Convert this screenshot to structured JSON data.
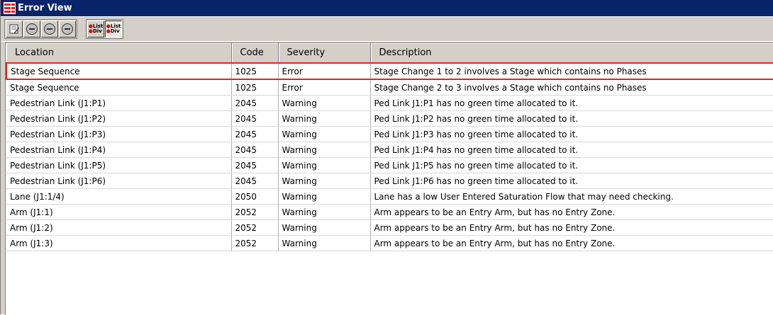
{
  "window": {
    "title": "Error View"
  },
  "toolbar": {
    "buttons": [
      {
        "name": "edit-icon"
      },
      {
        "name": "first-icon"
      },
      {
        "name": "previous-icon"
      },
      {
        "name": "next-icon"
      }
    ],
    "view_buttons": [
      {
        "name": "list-view-icon",
        "lines": [
          "List",
          "Div"
        ]
      },
      {
        "name": "detail-view-icon",
        "lines": [
          "List",
          "Div"
        ]
      }
    ]
  },
  "table": {
    "columns": [
      "Location",
      "Code",
      "Severity",
      "Description"
    ],
    "rows": [
      {
        "location": "Stage Sequence",
        "code": "1025",
        "severity": "Error",
        "description": "Stage Change 1 to 2 involves a Stage which contains no Phases"
      },
      {
        "location": "Stage Sequence",
        "code": "1025",
        "severity": "Error",
        "description": "Stage Change 2 to 3 involves a Stage which contains no Phases"
      },
      {
        "location": "Pedestrian Link (J1:P1)",
        "code": "2045",
        "severity": "Warning",
        "description": "Ped Link J1:P1 has no green time allocated to it."
      },
      {
        "location": "Pedestrian Link (J1:P2)",
        "code": "2045",
        "severity": "Warning",
        "description": "Ped Link J1:P2 has no green time allocated to it."
      },
      {
        "location": "Pedestrian Link (J1:P3)",
        "code": "2045",
        "severity": "Warning",
        "description": "Ped Link J1:P3 has no green time allocated to it."
      },
      {
        "location": "Pedestrian Link (J1:P4)",
        "code": "2045",
        "severity": "Warning",
        "description": "Ped Link J1:P4 has no green time allocated to it."
      },
      {
        "location": "Pedestrian Link (J1:P5)",
        "code": "2045",
        "severity": "Warning",
        "description": "Ped Link J1:P5 has no green time allocated to it."
      },
      {
        "location": "Pedestrian Link (J1:P6)",
        "code": "2045",
        "severity": "Warning",
        "description": "Ped Link J1:P6 has no green time allocated to it."
      },
      {
        "location": "Lane (J1:1/4)",
        "code": "2050",
        "severity": "Warning",
        "description": "Lane has a low User Entered Saturation Flow that may need checking."
      },
      {
        "location": "Arm (J1:1)",
        "code": "2052",
        "severity": "Warning",
        "description": "Arm appears to be an Entry Arm, but has no Entry Zone."
      },
      {
        "location": "Arm (J1:2)",
        "code": "2052",
        "severity": "Warning",
        "description": "Arm appears to be an Entry Arm, but has no Entry Zone."
      },
      {
        "location": "Arm (J1:3)",
        "code": "2052",
        "severity": "Warning",
        "description": "Arm appears to be an Entry Arm, but has no Entry Zone."
      }
    ]
  },
  "colors": {
    "titlebar": "#0a246a",
    "highlight": "#e82020",
    "chrome": "#d4d0c8"
  }
}
